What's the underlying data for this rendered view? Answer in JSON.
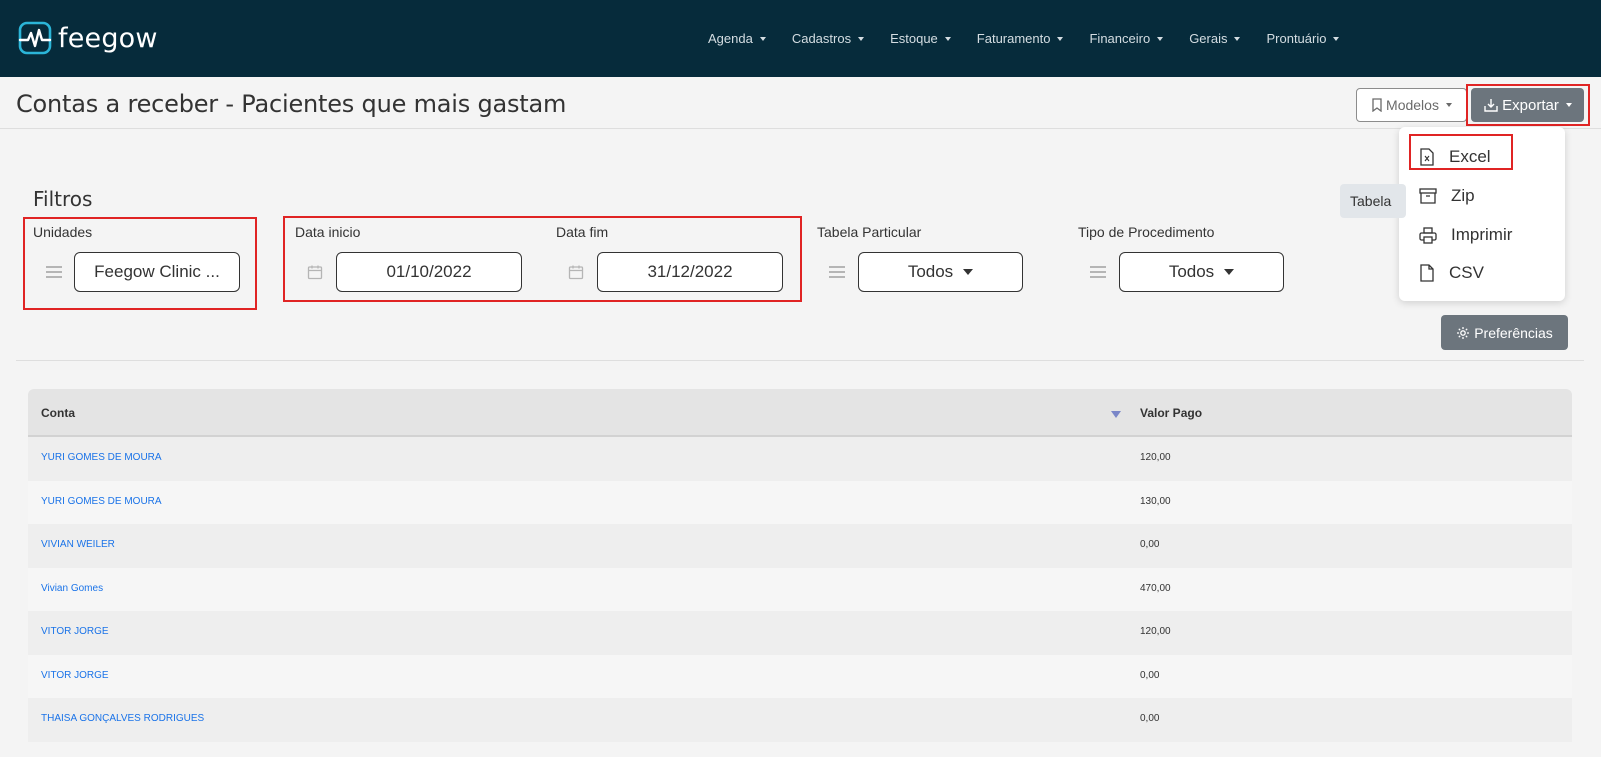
{
  "brand": {
    "name": "feegow"
  },
  "nav": {
    "items": [
      "Agenda",
      "Cadastros",
      "Estoque",
      "Faturamento",
      "Financeiro",
      "Gerais",
      "Prontuário"
    ]
  },
  "header": {
    "title": "Contas a receber - Pacientes que mais gastam",
    "modelos_label": "Modelos",
    "exportar_label": "Exportar"
  },
  "export_menu": {
    "items": [
      {
        "label": "Excel",
        "icon": "excel-file-icon"
      },
      {
        "label": "Zip",
        "icon": "archive-icon"
      },
      {
        "label": "Imprimir",
        "icon": "printer-icon"
      },
      {
        "label": "CSV",
        "icon": "file-icon"
      }
    ]
  },
  "filters": {
    "title": "Filtros",
    "tabela_chip": "Tabela",
    "unidades": {
      "label": "Unidades",
      "value": "Feegow Clinic ..."
    },
    "data_inicio": {
      "label": "Data inicio",
      "value": "01/10/2022"
    },
    "data_fim": {
      "label": "Data fim",
      "value": "31/12/2022"
    },
    "tabela_particular": {
      "label": "Tabela Particular",
      "value": "Todos"
    },
    "tipo_procedimento": {
      "label": "Tipo de Procedimento",
      "value": "Todos"
    },
    "preferencias_label": "Preferências"
  },
  "table": {
    "columns": [
      "Conta",
      "Valor Pago"
    ],
    "rows": [
      {
        "conta": "YURI GOMES DE MOURA",
        "valor": "120,00"
      },
      {
        "conta": "YURI GOMES DE MOURA",
        "valor": "130,00"
      },
      {
        "conta": "VIVIAN WEILER",
        "valor": "0,00"
      },
      {
        "conta": "Vivian Gomes",
        "valor": "470,00"
      },
      {
        "conta": "VITOR JORGE",
        "valor": "120,00"
      },
      {
        "conta": "VITOR JORGE",
        "valor": "0,00"
      },
      {
        "conta": "THAISA GONÇALVES RODRIGUES",
        "valor": "0,00"
      }
    ]
  },
  "colors": {
    "topbar": "#062b3b",
    "link": "#1a73e8",
    "highlight": "#e02424",
    "secondary_button": "#6c757d"
  }
}
